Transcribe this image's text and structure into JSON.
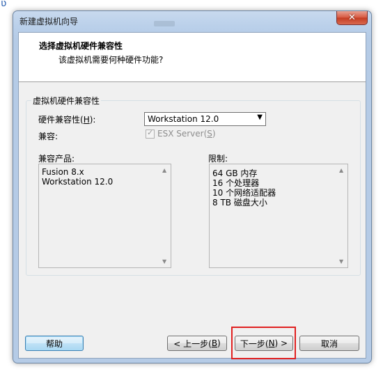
{
  "window": {
    "title": "新建虚拟机向导",
    "close_glyph": "✕"
  },
  "header": {
    "title": "选择虚拟机硬件兼容性",
    "subtitle": "该虚拟机需要何种硬件功能?"
  },
  "group": {
    "legend": "虚拟机硬件兼容性",
    "compat_label_pre": "硬件兼容性(",
    "compat_label_key": "H",
    "compat_label_post": "):",
    "compat_value": "Workstation 12.0",
    "compat_dropdown_icon": "chevron-down-icon",
    "compatible_label": "兼容:",
    "esx_label_pre": "ESX Server(",
    "esx_label_key": "S",
    "esx_label_post": ")",
    "esx_checked": true,
    "products_label": "兼容产品:",
    "products": [
      "Fusion 8.x",
      "Workstation 12.0"
    ],
    "limits_label": "限制:",
    "limits": [
      "64 GB 内存",
      "16 个处理器",
      "10 个网络适配器",
      "8 TB 磁盘大小"
    ]
  },
  "buttons": {
    "help": "帮助",
    "back_pre": "< 上一步(",
    "back_key": "B",
    "back_post": ")",
    "next_pre": "下一步(",
    "next_key": "N",
    "next_post": ") >",
    "cancel": "取消"
  },
  "colors": {
    "annotation_box": "#e02020",
    "close_button": "#c33c22"
  }
}
